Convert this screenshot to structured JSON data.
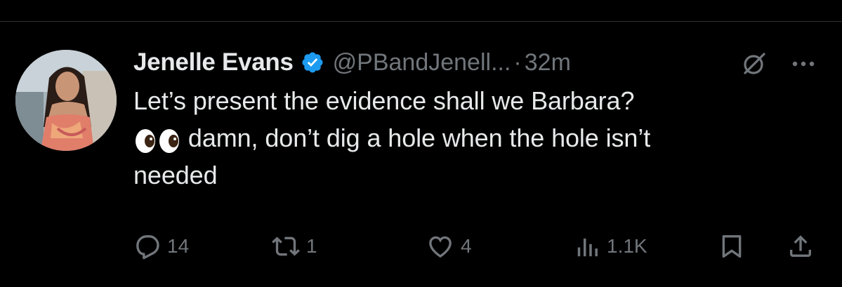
{
  "tweet": {
    "author_name": "Jenelle Evans",
    "handle": "@PBandJenell...",
    "separator": "·",
    "time": "32m",
    "text_line1": "Let’s present the evidence shall we Barbara?",
    "text_line2": " damn, don’t dig a hole when the hole isn’t",
    "text_line3": "needed",
    "emoji": "eyes-emoji",
    "verified_color": "#1d9bf0"
  },
  "actions": {
    "replies": "14",
    "reposts": "1",
    "likes": "4",
    "views": "1.1K"
  },
  "icons": {
    "reply": "reply-icon",
    "repost": "repost-icon",
    "like": "heart-icon",
    "views": "views-icon",
    "bookmark": "bookmark-icon",
    "share": "share-icon",
    "grok": "grok-icon",
    "more": "more-icon"
  }
}
